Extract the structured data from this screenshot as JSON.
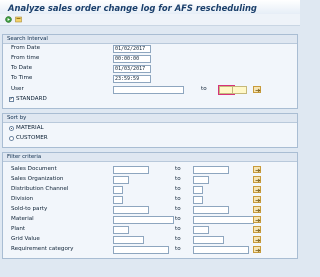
{
  "title": "Analyze sales order change log for AFS rescheduling",
  "toolbar": {
    "icons": [
      "execute-icon",
      "variant-icon"
    ]
  },
  "search_interval": {
    "header": "Search Interval",
    "from_date_label": "From Date",
    "from_date_value": "01/02/2017",
    "from_time_label": "From time",
    "from_time_value": "00:00:00",
    "to_date_label": "To Date",
    "to_date_value": "01/03/2017",
    "to_time_label": "To Time",
    "to_time_value": "23:59:59",
    "user_label": "User",
    "user_value": "",
    "to_label": "to",
    "user_to_value": "",
    "standard_label": "STANDARD",
    "standard_checked": true
  },
  "sort_by": {
    "header": "Sort by",
    "options": [
      "MATERIAL",
      "CUSTOMER"
    ],
    "selected": "MATERIAL"
  },
  "filter_criteria": {
    "header": "Filter criteria",
    "to_label": "to",
    "rows": [
      {
        "label": "Sales Document"
      },
      {
        "label": "Sales Organization"
      },
      {
        "label": "Distribution Channel"
      },
      {
        "label": "Division"
      },
      {
        "label": "Sold-to party"
      },
      {
        "label": "Material"
      },
      {
        "label": "Plant"
      },
      {
        "label": "Grid Value"
      },
      {
        "label": "Requirement category"
      }
    ]
  }
}
